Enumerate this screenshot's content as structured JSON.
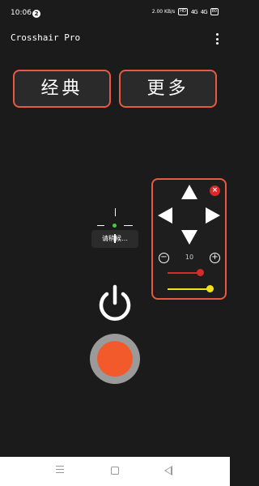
{
  "status_bar": {
    "time": "10:06",
    "notification_count": "2",
    "network_speed": "2.00 KB/s",
    "hd_label": "HD",
    "signal_1": "4G",
    "signal_2": "4G",
    "battery": "80"
  },
  "app_bar": {
    "title": "Crosshair  Pro",
    "menu_icon": "more-vert-icon"
  },
  "mode_buttons": {
    "classic_label": "经典",
    "more_label": "更多"
  },
  "toast": {
    "text": "请稍候…"
  },
  "control_panel": {
    "close_icon": "close-circle-icon",
    "step_value": "10",
    "red_slider_level": 1.0,
    "yellow_slider_level": 1.0
  },
  "colors": {
    "accent": "#e85a3f",
    "record": "#f25a2c",
    "crosshair_dot": "#3fcf3f",
    "slider_red": "#d62b2b",
    "slider_yellow": "#f2e21a"
  }
}
